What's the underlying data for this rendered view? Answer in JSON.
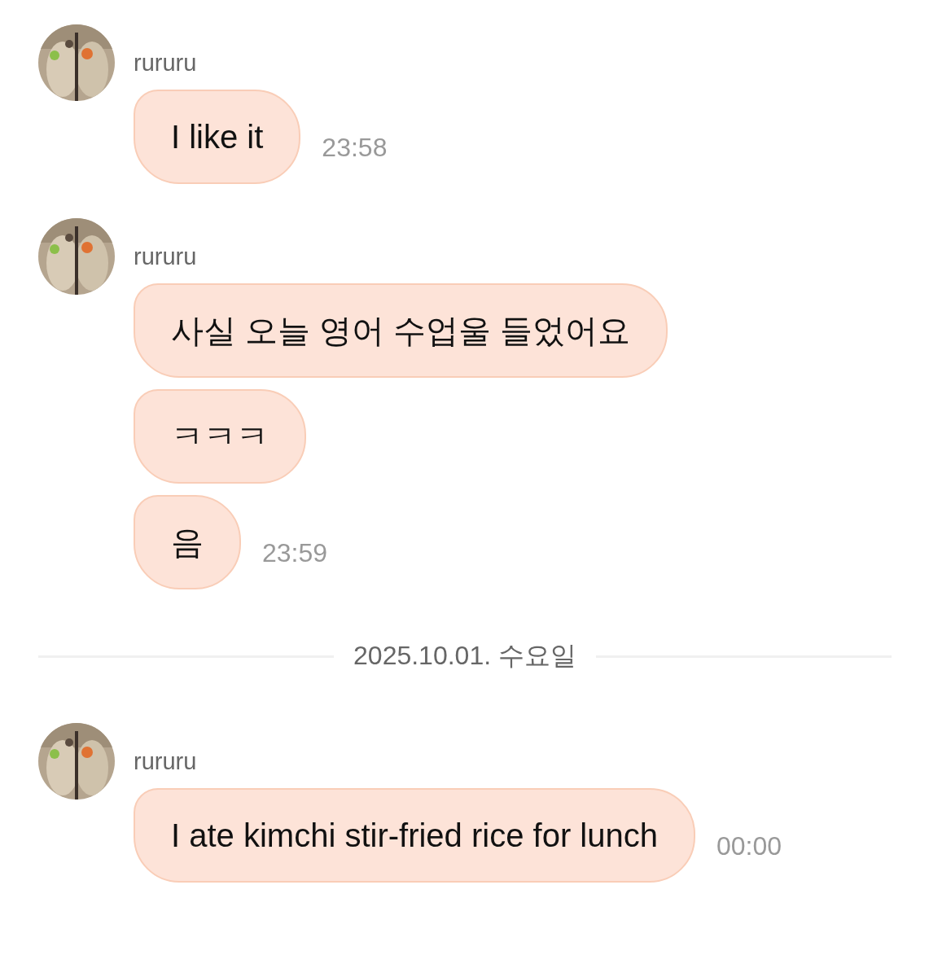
{
  "items": [
    {
      "kind": "group",
      "sender": "rururu",
      "avatar": {
        "kind": "picture"
      },
      "messages": [
        {
          "text": "I like it",
          "time": "23:58"
        }
      ]
    },
    {
      "kind": "group",
      "sender": "rururu",
      "avatar": {
        "kind": "picture"
      },
      "messages": [
        {
          "text": "사실 오늘 영어 수업울 들었어요"
        },
        {
          "text": "ㅋㅋㅋ"
        },
        {
          "text": "음",
          "time": "23:59"
        }
      ]
    },
    {
      "kind": "date",
      "label": "2025.10.01. 수요일"
    },
    {
      "kind": "group",
      "sender": "rururu",
      "avatar": {
        "kind": "picture"
      },
      "messages": [
        {
          "text": "I ate kimchi stir-fried rice for lunch",
          "time": "00:00"
        }
      ]
    }
  ]
}
